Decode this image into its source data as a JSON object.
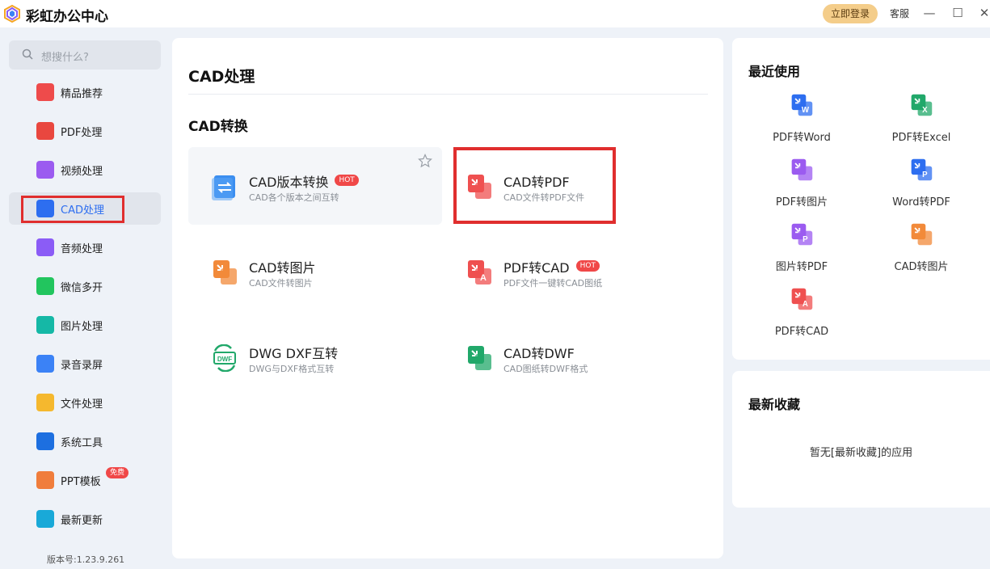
{
  "app": {
    "title": "彩虹办公中心",
    "login_label": "立即登录",
    "service_label": "客服"
  },
  "window_controls": {
    "minimize": "—",
    "maximize": "☐",
    "close": "✕"
  },
  "search": {
    "placeholder": "想搜什么?"
  },
  "sidebar": {
    "items": [
      {
        "label": "精品推荐",
        "icon": "thumbs-up-icon",
        "color": "#ee4b4b"
      },
      {
        "label": "PDF处理",
        "icon": "pdf-icon",
        "color": "#e9473f"
      },
      {
        "label": "视频处理",
        "icon": "play-icon",
        "color": "#9b5bf0"
      },
      {
        "label": "CAD处理",
        "icon": "cad-icon",
        "color": "#2d6ef0"
      },
      {
        "label": "音频处理",
        "icon": "music-icon",
        "color": "#8b5cf6"
      },
      {
        "label": "微信多开",
        "icon": "wechat-icon",
        "color": "#22c55e"
      },
      {
        "label": "图片处理",
        "icon": "image-icon",
        "color": "#15b8a6"
      },
      {
        "label": "录音录屏",
        "icon": "microphone-icon",
        "color": "#3b82f6"
      },
      {
        "label": "文件处理",
        "icon": "folder-icon",
        "color": "#f5b82e"
      },
      {
        "label": "系统工具",
        "icon": "gear-icon",
        "color": "#1d6fe0"
      },
      {
        "label": "PPT模板",
        "icon": "ppt-icon",
        "color": "#f07d3c",
        "badge": "免费"
      },
      {
        "label": "最新更新",
        "icon": "upload-icon",
        "color": "#19a9d8"
      }
    ],
    "version": "版本号:1.23.9.261"
  },
  "main": {
    "title": "CAD处理",
    "section": "CAD转换",
    "cards": [
      {
        "title": "CAD版本转换",
        "subtitle": "CAD各个版本之间互转",
        "badge": "HOT",
        "icon": "convert-icon",
        "color": "#3b8ef0"
      },
      {
        "title": "CAD转PDF",
        "subtitle": "CAD文件转PDF文件",
        "icon": "cad-to-pdf-icon",
        "color": "#ef5050"
      },
      {
        "title": "CAD转图片",
        "subtitle": "CAD文件转图片",
        "icon": "cad-to-image-icon",
        "color": "#f28a3a"
      },
      {
        "title": "PDF转CAD",
        "subtitle": "PDF文件一键转CAD图纸",
        "badge": "HOT",
        "icon": "pdf-to-cad-icon",
        "color": "#ef5050"
      },
      {
        "title": "DWG DXF互转",
        "subtitle": "DWG与DXF格式互转",
        "icon": "dwg-dxf-icon",
        "color": "#21a86a"
      },
      {
        "title": "CAD转DWF",
        "subtitle": "CAD图纸转DWF格式",
        "icon": "cad-to-dwf-icon",
        "color": "#21a86a"
      }
    ]
  },
  "recent": {
    "title": "最近使用",
    "items": [
      {
        "label": "PDF转Word",
        "icon": "pdf-to-word-icon",
        "color": "#2d6ef0",
        "glyph": "W"
      },
      {
        "label": "PDF转Excel",
        "icon": "pdf-to-excel-icon",
        "color": "#21a86a",
        "glyph": "X"
      },
      {
        "label": "PDF转图片",
        "icon": "pdf-to-image-icon",
        "color": "#9b5bf0",
        "glyph": ""
      },
      {
        "label": "Word转PDF",
        "icon": "word-to-pdf-icon",
        "color": "#2d6ef0",
        "glyph": "P"
      },
      {
        "label": "图片转PDF",
        "icon": "image-to-pdf-icon",
        "color": "#9b5bf0",
        "glyph": "P"
      },
      {
        "label": "CAD转图片",
        "icon": "cad-to-image-icon",
        "color": "#f28a3a",
        "glyph": ""
      },
      {
        "label": "PDF转CAD",
        "icon": "pdf-to-cad-icon",
        "color": "#ef5050",
        "glyph": "A"
      }
    ]
  },
  "favorites": {
    "title": "最新收藏",
    "empty_text": "暂无[最新收藏]的应用"
  }
}
